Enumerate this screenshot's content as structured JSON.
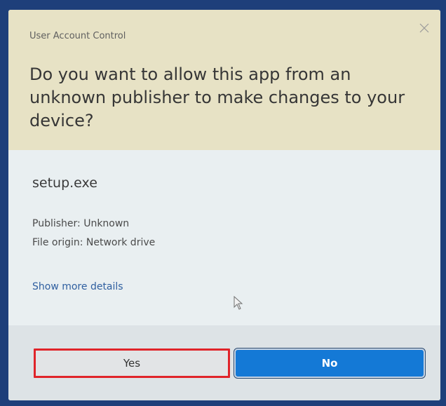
{
  "dialog": {
    "title": "User Account Control",
    "question": "Do you want to allow this app from an unknown publisher to make changes to your device?",
    "app_name": "setup.exe",
    "publisher": "Publisher: Unknown",
    "file_origin": "File origin: Network drive",
    "show_more": "Show more details",
    "yes_label": "Yes",
    "no_label": "No",
    "close_icon": "close-icon"
  },
  "colors": {
    "header_bg": "#e7e2c5",
    "body_bg": "#e9eff1",
    "footer_bg": "#dde3e6",
    "no_button": "#1479d6",
    "yes_highlight": "#e0242a",
    "link": "#2f5fa0"
  }
}
